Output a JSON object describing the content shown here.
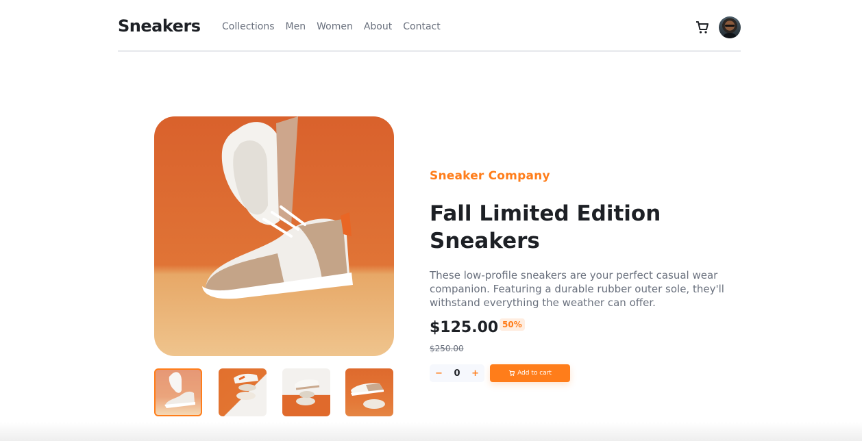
{
  "header": {
    "logo": "Sneakers",
    "nav": [
      "Collections",
      "Men",
      "Women",
      "About",
      "Contact"
    ]
  },
  "icons": {
    "cart": "cart-icon",
    "avatar": "avatar",
    "minus": "minus-icon",
    "plus": "plus-icon"
  },
  "product": {
    "brand": "Sneaker Company",
    "title": "Fall Limited Edition Sneakers",
    "description": "These low-profile sneakers are your perfect casual wear companion. Featuring a durable rubber outer sole, they'll withstand everything the weather can offer.",
    "price": "$125.00",
    "discount": "50%",
    "old_price": "$250.00"
  },
  "cart_controls": {
    "minus": "−",
    "quantity": "0",
    "plus": "+",
    "add_label": "Add to cart"
  },
  "colors": {
    "accent": "#ff7d1a",
    "accent_pale": "#ffede0",
    "text_dark": "#1d2025",
    "text_gray": "#69707d"
  }
}
